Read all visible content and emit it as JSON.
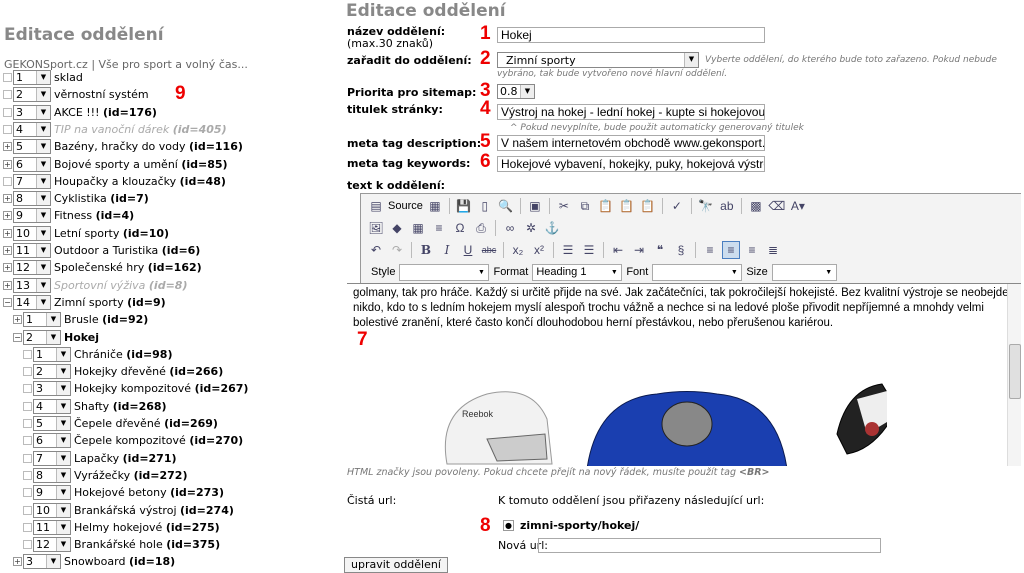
{
  "left": {
    "title": "Editace oddělení",
    "site": "GEKONSport.cz | Vše pro sport a volný čas...",
    "marker": "9",
    "tree": [
      {
        "exp": "none",
        "order": "1",
        "name": "sklad",
        "id": "",
        "style": "normal",
        "level": 0
      },
      {
        "exp": "none",
        "order": "2",
        "name": "věrnostní systém",
        "id": "",
        "style": "normal",
        "level": 0
      },
      {
        "exp": "none",
        "order": "3",
        "name": "AKCE !!!",
        "id": "(id=176)",
        "style": "normal",
        "level": 0
      },
      {
        "exp": "none",
        "order": "4",
        "name": "TIP na vanoční dárek",
        "id": "(id=405)",
        "style": "disabled",
        "level": 0
      },
      {
        "exp": "plus",
        "order": "5",
        "name": "Bazény, hračky do vody",
        "id": "(id=116)",
        "style": "normal",
        "level": 0
      },
      {
        "exp": "plus",
        "order": "6",
        "name": "Bojové sporty a umění",
        "id": "(id=85)",
        "style": "normal",
        "level": 0
      },
      {
        "exp": "none",
        "order": "7",
        "name": "Houpačky a klouzačky",
        "id": "(id=48)",
        "style": "normal",
        "level": 0
      },
      {
        "exp": "plus",
        "order": "8",
        "name": "Cyklistika",
        "id": "(id=7)",
        "style": "normal",
        "level": 0
      },
      {
        "exp": "plus",
        "order": "9",
        "name": "Fitness",
        "id": "(id=4)",
        "style": "normal",
        "level": 0
      },
      {
        "exp": "plus",
        "order": "10",
        "name": "Letní sporty",
        "id": "(id=10)",
        "style": "normal",
        "level": 0
      },
      {
        "exp": "plus",
        "order": "11",
        "name": "Outdoor a Turistika",
        "id": "(id=6)",
        "style": "normal",
        "level": 0
      },
      {
        "exp": "plus",
        "order": "12",
        "name": "Společenské hry",
        "id": "(id=162)",
        "style": "normal",
        "level": 0
      },
      {
        "exp": "plus",
        "order": "13",
        "name": "Sportovní výživa",
        "id": "(id=8)",
        "style": "disabled",
        "level": 0
      },
      {
        "exp": "minus",
        "order": "14",
        "name": "Zimní sporty",
        "id": "(id=9)",
        "style": "normal",
        "level": 0
      },
      {
        "exp": "plus",
        "order": "1",
        "name": "Brusle",
        "id": "(id=92)",
        "style": "normal",
        "level": 1
      },
      {
        "exp": "minus",
        "order": "2",
        "name": "Hokej",
        "id": "",
        "style": "bold",
        "level": 1
      },
      {
        "exp": "none",
        "order": "1",
        "name": "Chrániče",
        "id": "(id=98)",
        "style": "normal",
        "level": 2
      },
      {
        "exp": "none",
        "order": "2",
        "name": "Hokejky dřevěné",
        "id": "(id=266)",
        "style": "normal",
        "level": 2
      },
      {
        "exp": "none",
        "order": "3",
        "name": "Hokejky kompozitové",
        "id": "(id=267)",
        "style": "normal",
        "level": 2
      },
      {
        "exp": "none",
        "order": "4",
        "name": "Shafty",
        "id": "(id=268)",
        "style": "normal",
        "level": 2
      },
      {
        "exp": "none",
        "order": "5",
        "name": "Čepele dřevěné",
        "id": "(id=269)",
        "style": "normal",
        "level": 2
      },
      {
        "exp": "none",
        "order": "6",
        "name": "Čepele kompozitové",
        "id": "(id=270)",
        "style": "normal",
        "level": 2
      },
      {
        "exp": "none",
        "order": "7",
        "name": "Lapačky",
        "id": "(id=271)",
        "style": "normal",
        "level": 2
      },
      {
        "exp": "none",
        "order": "8",
        "name": "Vyrážečky",
        "id": "(id=272)",
        "style": "normal",
        "level": 2
      },
      {
        "exp": "none",
        "order": "9",
        "name": "Hokejové betony",
        "id": "(id=273)",
        "style": "normal",
        "level": 2
      },
      {
        "exp": "none",
        "order": "10",
        "name": "Brankářská výstroj",
        "id": "(id=274)",
        "style": "normal",
        "level": 2
      },
      {
        "exp": "none",
        "order": "11",
        "name": "Helmy hokejové",
        "id": "(id=275)",
        "style": "normal",
        "level": 2
      },
      {
        "exp": "none",
        "order": "12",
        "name": "Brankářské hole",
        "id": "(id=375)",
        "style": "normal",
        "level": 2
      },
      {
        "exp": "plus",
        "order": "3",
        "name": "Snowboard",
        "id": "(id=18)",
        "style": "normal",
        "level": 1
      }
    ]
  },
  "form": {
    "title": "Editace oddělení",
    "name_label": "název oddělení:",
    "name_sub": "(max.30 znaků)",
    "name_value": "Hokej",
    "parent_label": "zařadit do oddělení:",
    "parent_value": "Zimní sporty",
    "parent_hint": "Vyberte oddělení, do kterého bude toto zařazeno. Pokud nebude",
    "parent_hint2": "vybráno, tak bude vytvořeno nové hlavní oddělení.",
    "priority_label": "Priorita pro sitemap:",
    "priority_value": "0.8",
    "title_label": "titulek stránky:",
    "title_value": "Výstroj na hokej - lední hokej - kupte si hokejovou",
    "title_hint": "^ Pokud nevyplníte, bude použit automaticky generovaný titulek",
    "desc_label": "meta tag description:",
    "desc_value": "V našem internetovém obchodě www.gekonsport.cz",
    "kw_label": "meta tag keywords:",
    "kw_value": "Hokejové vybavení, hokejky, puky, hokejová výstroj",
    "text_label": "text k oddělení:",
    "html_hint": "HTML značky jsou povoleny. Pokud chcete přejít na nový řádek, musíte použít tag ",
    "html_hint_tag": "<BR>",
    "clean_url_label": "Čistá url:",
    "assigned_label": "K tomuto oddělení jsou přiřazeny následující url:",
    "url_value": "zimni-sporty/hokej/",
    "new_url_label": "Nová url:",
    "new_url_value": "",
    "submit": "upravit oddělení",
    "markers": [
      "1",
      "2",
      "3",
      "4",
      "5",
      "6",
      "7",
      "8"
    ]
  },
  "editor": {
    "source_label": "Source",
    "style_label": "Style",
    "style_value": "",
    "format_label": "Format",
    "format_value": "Heading 1",
    "font_label": "Font",
    "font_value": "",
    "size_label": "Size",
    "size_value": "",
    "content": [
      "golmany, tak pro hráče. Každý si určitě přijde na své. Jak začátečníci, tak pokročilejší hokejisté. Bez kvalitní výstroje se neobejde",
      "nikdo, kdo to s ledním hokejem myslí alespoň trochu vážně a nechce si na ledové ploše přivodit nepříjemné a mnohdy velmi",
      "bolestivé zranění, které často končí dlouhodobou herní přestávkou, nebo přerušenou kariérou."
    ],
    "image_text": "Reebok"
  },
  "colors": {
    "marker": "#e00000",
    "heading": "#888888"
  }
}
